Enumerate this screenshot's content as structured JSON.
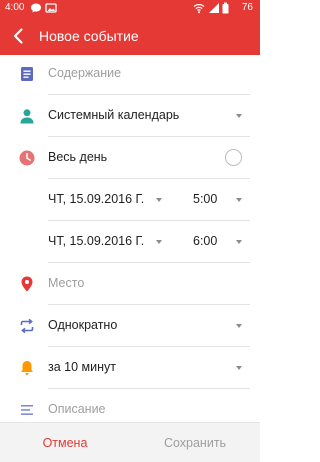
{
  "status_bar": {
    "time": "4:00",
    "battery": "76",
    "icons": [
      "chat-bubble-icon",
      "image-icon",
      "wifi-icon",
      "signal-icon",
      "battery-icon"
    ]
  },
  "app_bar": {
    "title": "Новое событие",
    "back_icon": "back-arrow-icon"
  },
  "form": {
    "content_placeholder": "Содержание",
    "calendar": "Системный календарь",
    "all_day_label": "Весь день",
    "all_day_checked": false,
    "start": {
      "date": "ЧТ, 15.09.2016 Г.",
      "time": "5:00"
    },
    "end": {
      "date": "ЧТ, 15.09.2016 Г.",
      "time": "6:00"
    },
    "location_placeholder": "Место",
    "repeat": "Однократно",
    "reminder": "за 10 минут",
    "description_placeholder": "Описание"
  },
  "actions": {
    "cancel": "Отмена",
    "save": "Сохранить"
  },
  "colors": {
    "accent": "#e53935",
    "content_icon": "#5c6bc0",
    "calendar_icon": "#26a69a",
    "allday_icon": "#e57373",
    "location_icon": "#e53935",
    "repeat_icon": "#5c6bc0",
    "reminder_icon": "#ff9800",
    "description_icon": "#7986cb"
  }
}
